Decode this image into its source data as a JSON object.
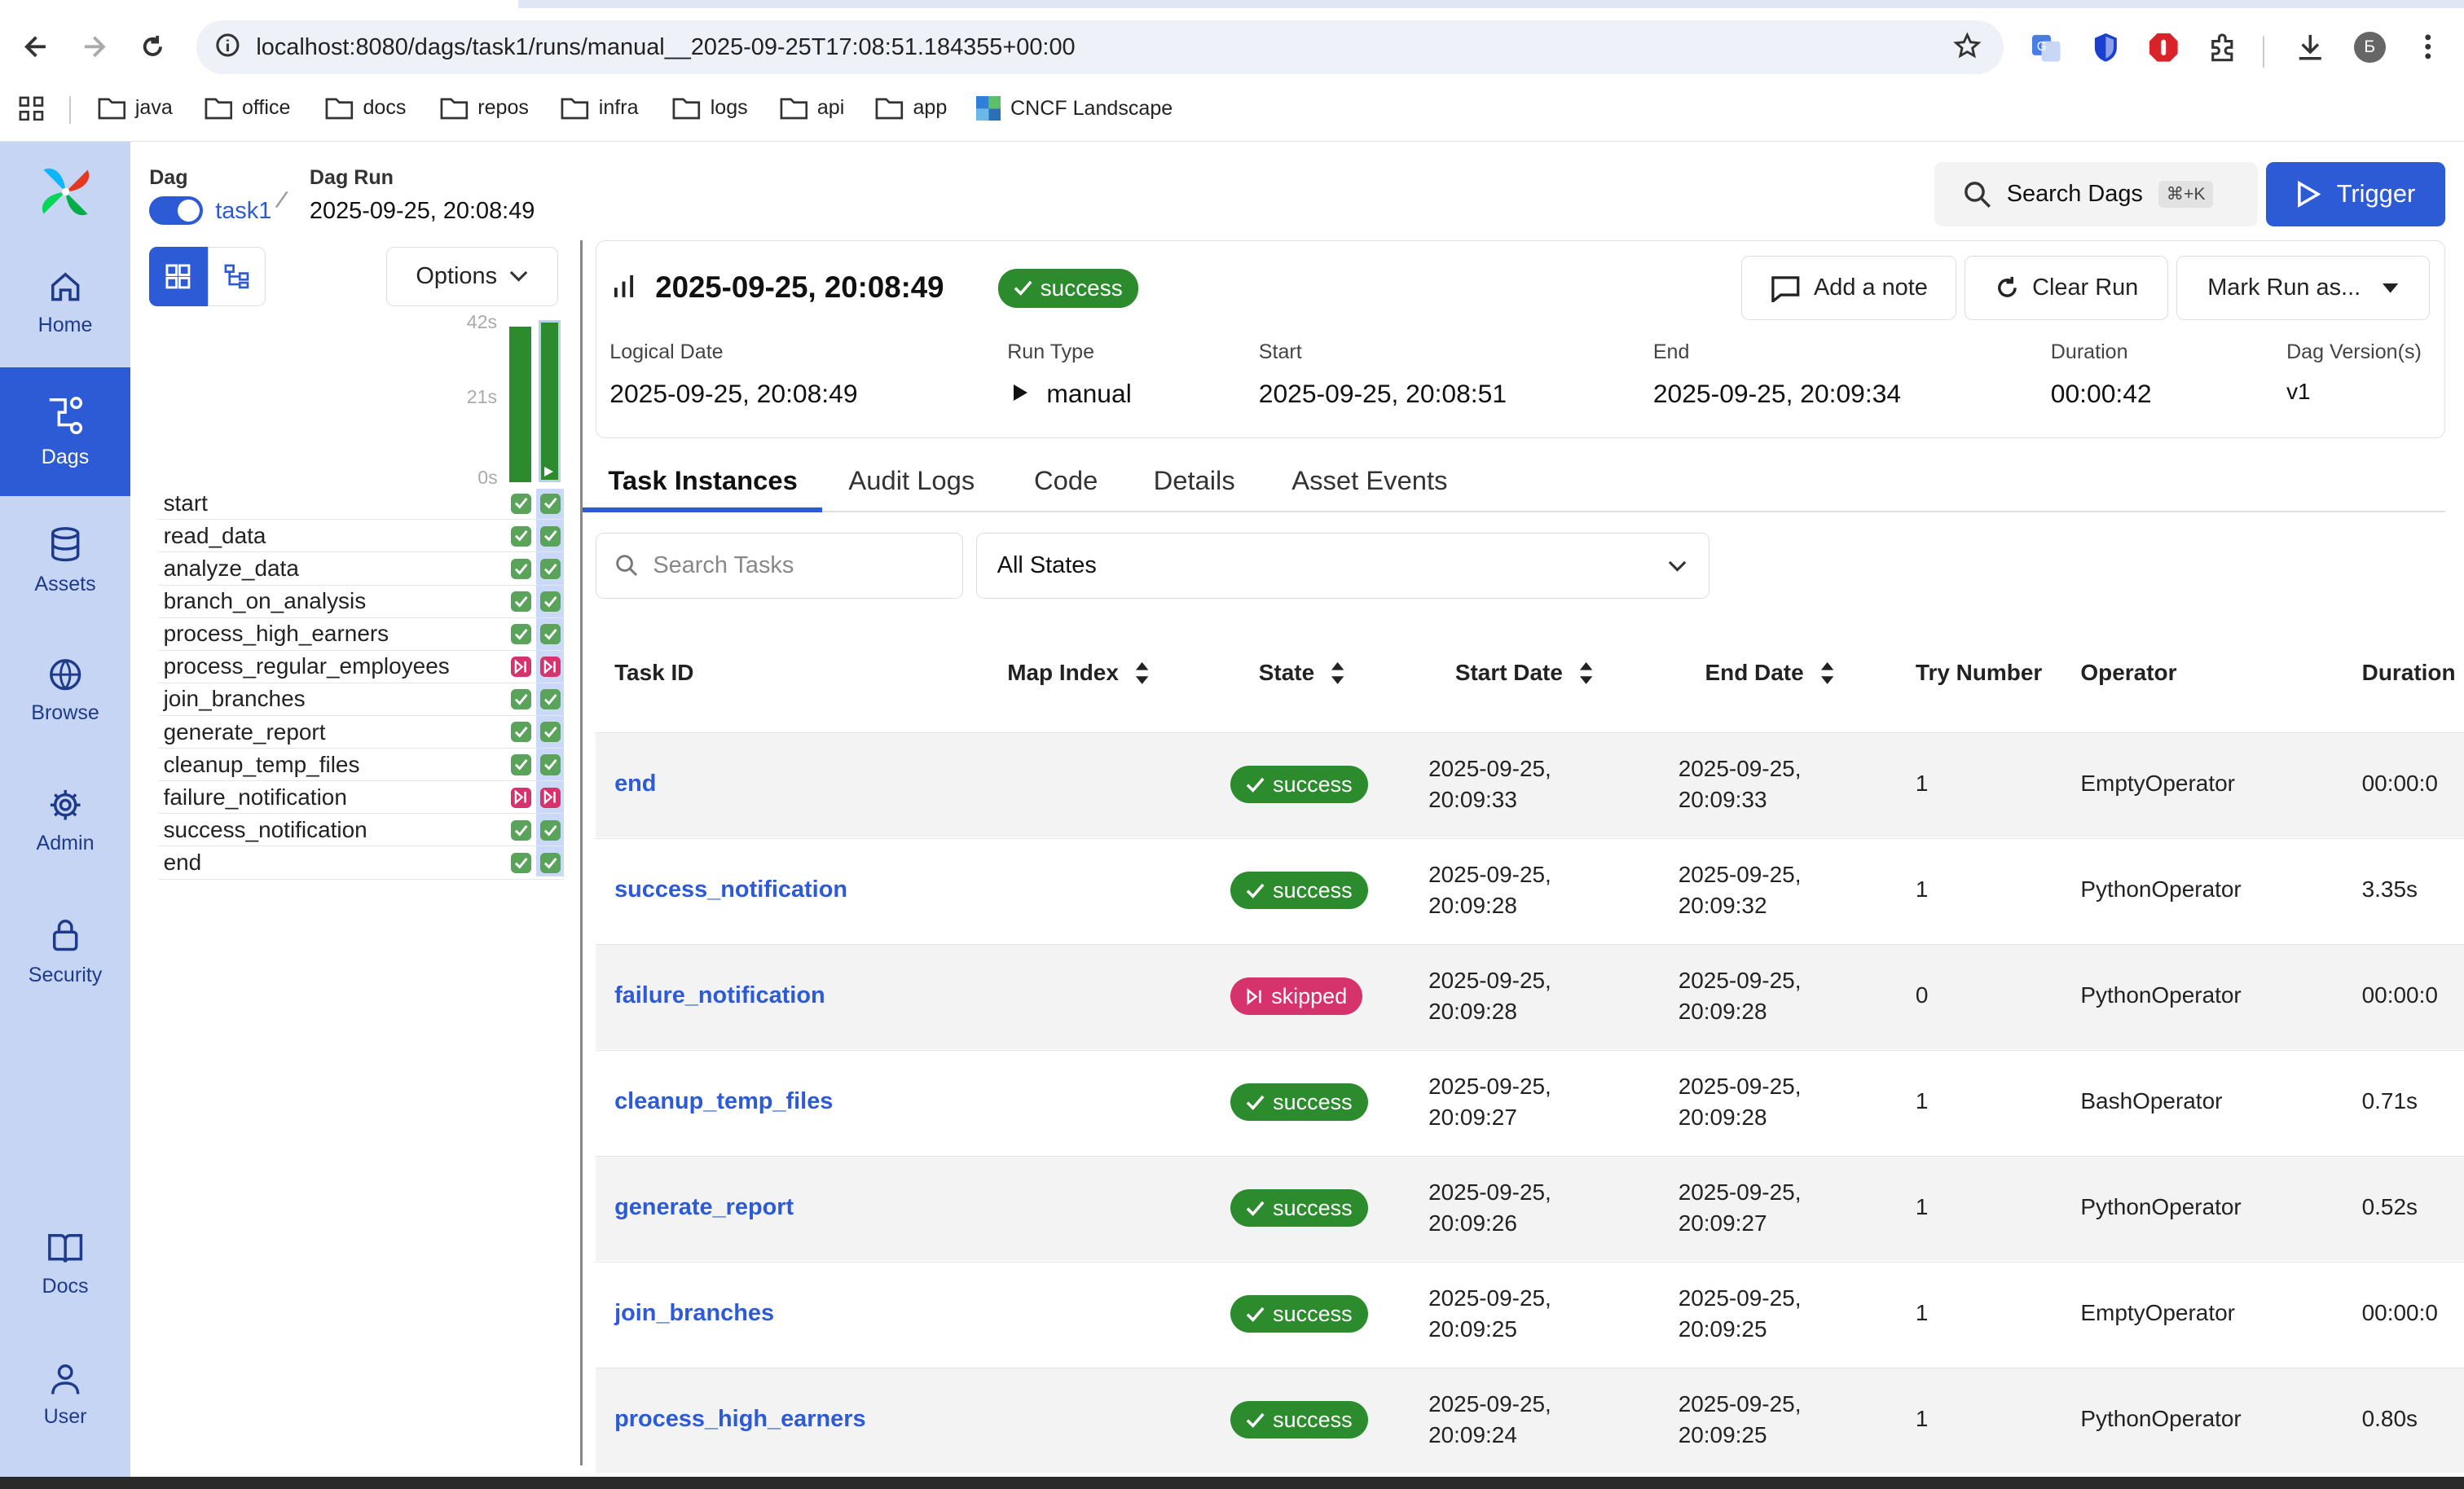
{
  "browser": {
    "url": "localhost:8080/dags/task1/runs/manual__2025-09-25T17:08:51.184355+00:00",
    "avatar_letter": "Б"
  },
  "bookmarks": [
    "java",
    "office",
    "docs",
    "repos",
    "infra",
    "logs",
    "api",
    "app",
    "CNCF Landscape"
  ],
  "sidebar": {
    "items": [
      "Home",
      "Dags",
      "Assets",
      "Browse",
      "Admin",
      "Security",
      "Docs",
      "User"
    ],
    "active": "Dags"
  },
  "header": {
    "dag_label": "Dag",
    "dag_name": "task1",
    "dagrun_label": "Dag Run",
    "dagrun_value": "2025-09-25, 20:08:49",
    "search_label": "Search Dags",
    "search_shortcut": "⌘+K",
    "trigger_label": "Trigger"
  },
  "grid": {
    "options_label": "Options",
    "axis": [
      "42s",
      "21s",
      "0s"
    ],
    "tasks": [
      {
        "name": "start",
        "s1": "success",
        "s2": "success"
      },
      {
        "name": "read_data",
        "s1": "success",
        "s2": "success"
      },
      {
        "name": "analyze_data",
        "s1": "success",
        "s2": "success"
      },
      {
        "name": "branch_on_analysis",
        "s1": "success",
        "s2": "success"
      },
      {
        "name": "process_high_earners",
        "s1": "success",
        "s2": "success"
      },
      {
        "name": "process_regular_employees",
        "s1": "skipped",
        "s2": "skipped"
      },
      {
        "name": "join_branches",
        "s1": "success",
        "s2": "success"
      },
      {
        "name": "generate_report",
        "s1": "success",
        "s2": "success"
      },
      {
        "name": "cleanup_temp_files",
        "s1": "success",
        "s2": "success"
      },
      {
        "name": "failure_notification",
        "s1": "skipped",
        "s2": "skipped"
      },
      {
        "name": "success_notification",
        "s1": "success",
        "s2": "success"
      },
      {
        "name": "end",
        "s1": "success",
        "s2": "success"
      }
    ]
  },
  "run": {
    "title": "2025-09-25, 20:08:49",
    "state": "success",
    "add_note": "Add a note",
    "clear_run": "Clear Run",
    "mark_run": "Mark Run as...",
    "meta": [
      {
        "label": "Logical Date",
        "value": "2025-09-25, 20:08:49"
      },
      {
        "label": "Run Type",
        "value": "manual"
      },
      {
        "label": "Start",
        "value": "2025-09-25, 20:08:51"
      },
      {
        "label": "End",
        "value": "2025-09-25, 20:09:34"
      },
      {
        "label": "Duration",
        "value": "00:00:42"
      },
      {
        "label": "Dag Version(s)",
        "value": "v1"
      }
    ]
  },
  "tabs": [
    "Task Instances",
    "Audit Logs",
    "Code",
    "Details",
    "Asset Events"
  ],
  "filters": {
    "search_placeholder": "Search Tasks",
    "state_select": "All States"
  },
  "table": {
    "columns": [
      "Task ID",
      "Map Index",
      "State",
      "Start Date",
      "End Date",
      "Try Number",
      "Operator",
      "Duration"
    ],
    "rows": [
      {
        "task": "end",
        "state": "success",
        "start": [
          "2025-09-25,",
          "20:09:33"
        ],
        "end": [
          "2025-09-25,",
          "20:09:33"
        ],
        "try": "1",
        "op": "EmptyOperator",
        "dur": "00:00:0"
      },
      {
        "task": "success_notification",
        "state": "success",
        "start": [
          "2025-09-25,",
          "20:09:28"
        ],
        "end": [
          "2025-09-25,",
          "20:09:32"
        ],
        "try": "1",
        "op": "PythonOperator",
        "dur": "3.35s"
      },
      {
        "task": "failure_notification",
        "state": "skipped",
        "start": [
          "2025-09-25,",
          "20:09:28"
        ],
        "end": [
          "2025-09-25,",
          "20:09:28"
        ],
        "try": "0",
        "op": "PythonOperator",
        "dur": "00:00:0"
      },
      {
        "task": "cleanup_temp_files",
        "state": "success",
        "start": [
          "2025-09-25,",
          "20:09:27"
        ],
        "end": [
          "2025-09-25,",
          "20:09:28"
        ],
        "try": "1",
        "op": "BashOperator",
        "dur": "0.71s"
      },
      {
        "task": "generate_report",
        "state": "success",
        "start": [
          "2025-09-25,",
          "20:09:26"
        ],
        "end": [
          "2025-09-25,",
          "20:09:27"
        ],
        "try": "1",
        "op": "PythonOperator",
        "dur": "0.52s"
      },
      {
        "task": "join_branches",
        "state": "success",
        "start": [
          "2025-09-25,",
          "20:09:25"
        ],
        "end": [
          "2025-09-25,",
          "20:09:25"
        ],
        "try": "1",
        "op": "EmptyOperator",
        "dur": "00:00:0"
      },
      {
        "task": "process_high_earners",
        "state": "success",
        "start": [
          "2025-09-25,",
          "20:09:24"
        ],
        "end": [
          "2025-09-25,",
          "20:09:25"
        ],
        "try": "1",
        "op": "PythonOperator",
        "dur": "0.80s"
      }
    ]
  },
  "colors": {
    "accent": "#2d5bd6",
    "success": "#2c8b2c",
    "skipped": "#d6336c",
    "sidebar": "#c7d5f4"
  }
}
